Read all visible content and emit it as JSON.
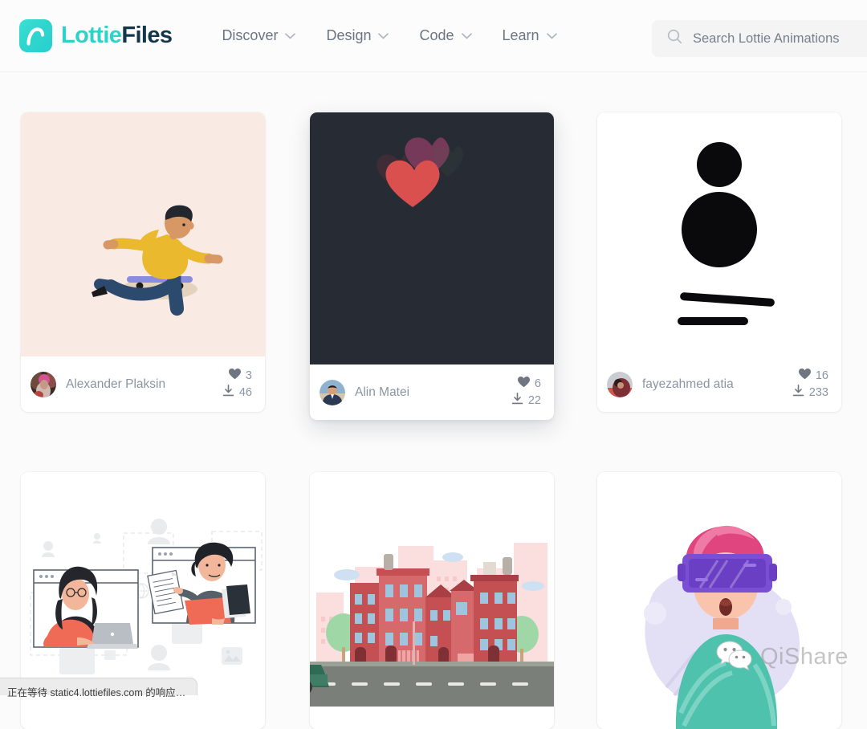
{
  "header": {
    "brand": {
      "part1": "Lottie",
      "part2": "Files",
      "logo_icon": "lottiefiles-logo-icon"
    },
    "nav": [
      {
        "label": "Discover",
        "icon": "chevron-down-icon"
      },
      {
        "label": "Design",
        "icon": "chevron-down-icon"
      },
      {
        "label": "Code",
        "icon": "chevron-down-icon"
      },
      {
        "label": "Learn",
        "icon": "chevron-down-icon"
      }
    ],
    "search": {
      "placeholder": "Search Lottie Animations",
      "value": "",
      "icon": "search-icon"
    }
  },
  "cards": [
    {
      "thumb_name": "skateboarder-animation-thumbnail",
      "author": "Alexander Plaksin",
      "likes": "3",
      "downloads": "46",
      "bg": "#faeae4",
      "hovered": false
    },
    {
      "thumb_name": "hearts-animation-thumbnail",
      "author": "Alin Matei",
      "likes": "6",
      "downloads": "22",
      "bg": "#272c34",
      "hovered": true
    },
    {
      "thumb_name": "balancing-shapes-animation-thumbnail",
      "author": "fayezahmed atia",
      "likes": "16",
      "downloads": "233",
      "bg": "#ffffff",
      "hovered": false
    },
    {
      "thumb_name": "remote-collaboration-animation-thumbnail",
      "author": "",
      "likes": "",
      "downloads": "",
      "bg": "#ffffff",
      "hovered": false
    },
    {
      "thumb_name": "city-street-animation-thumbnail",
      "author": "",
      "likes": "",
      "downloads": "",
      "bg": "#ffffff",
      "hovered": false
    },
    {
      "thumb_name": "vr-headset-person-animation-thumbnail",
      "author": "",
      "likes": "",
      "downloads": "",
      "bg": "#ffffff",
      "hovered": false
    }
  ],
  "icons": {
    "heart": "heart-icon",
    "download": "download-icon"
  },
  "statusbar": {
    "text": "正在等待 static4.lottiefiles.com 的响应…"
  },
  "watermark": {
    "text": "QiShare",
    "icon": "wechat-icon"
  },
  "colors": {
    "brand_teal": "#2fd1c8",
    "brand_dark": "#13364a",
    "page_bg": "#fbfbfb",
    "muted_text": "#8b95a1",
    "nav_text": "#6b7582"
  }
}
